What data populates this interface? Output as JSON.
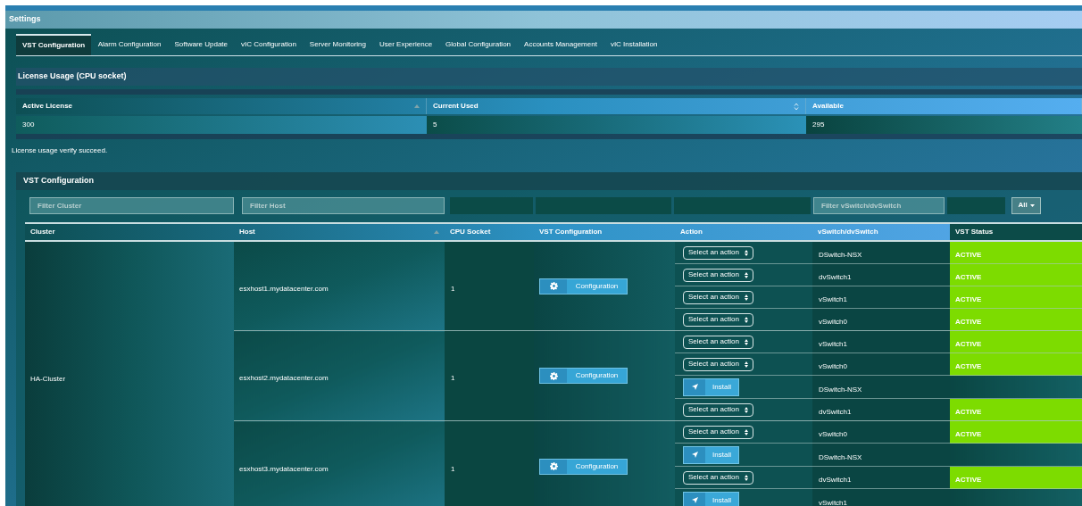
{
  "window": {
    "title": "Settings"
  },
  "tabs": [
    {
      "label": "VST Configuration",
      "selected": true
    },
    {
      "label": "Alarm Configuration",
      "selected": false
    },
    {
      "label": "Software Update",
      "selected": false
    },
    {
      "label": "vIC Configuration",
      "selected": false
    },
    {
      "label": "Server Monitoring",
      "selected": false
    },
    {
      "label": "User Experience",
      "selected": false
    },
    {
      "label": "Global Configuration",
      "selected": false
    },
    {
      "label": "Accounts Management",
      "selected": false
    },
    {
      "label": "vIC Installation",
      "selected": false
    }
  ],
  "license": {
    "title": "License Usage (CPU socket)",
    "columns": [
      {
        "label": "Active License",
        "sorted_ascending": true
      },
      {
        "label": "Current Used",
        "sortable": true
      },
      {
        "label": "Available"
      }
    ],
    "row": [
      "300",
      "5",
      "295"
    ],
    "message": "License usage verify succeed."
  },
  "vst": {
    "title": "VST Configuration",
    "filters": [
      {
        "placeholder": "Filter Cluster"
      },
      {
        "placeholder": "Filter Host"
      },
      {
        "placeholder": "Filter vSwitch/dvSwitch"
      }
    ],
    "status_filter": {
      "value": "All"
    },
    "columns": [
      {
        "label": "Cluster"
      },
      {
        "label": "Host",
        "sorted_ascending": true
      },
      {
        "label": "CPU Socket"
      },
      {
        "label": "VST Configuration"
      },
      {
        "label": "Action"
      },
      {
        "label": "vSwitch/dvSwitch"
      },
      {
        "label": "VST Status"
      }
    ],
    "clusters": [
      {
        "name": "HA-Cluster",
        "hosts": [
          {
            "host": "esxhost1.mydatacenter.com",
            "cpu": "1",
            "button": "Configuration",
            "switches": [
              {
                "action": {
                  "kind": "select",
                  "label": "Select an action"
                },
                "name": "DSwitch-NSX",
                "status": "ACTIVE"
              },
              {
                "action": {
                  "kind": "select",
                  "label": "Select an action"
                },
                "name": "dvSwitch1",
                "status": "ACTIVE"
              },
              {
                "action": {
                  "kind": "select",
                  "label": "Select an action"
                },
                "name": "vSwitch1",
                "status": "ACTIVE"
              },
              {
                "action": {
                  "kind": "select",
                  "label": "Select an action"
                },
                "name": "vSwitch0",
                "status": "ACTIVE"
              }
            ]
          },
          {
            "host": "esxhost2.mydatacenter.com",
            "cpu": "1",
            "button": "Configuration",
            "switches": [
              {
                "action": {
                  "kind": "select",
                  "label": "Select an action"
                },
                "name": "vSwitch1",
                "status": "ACTIVE"
              },
              {
                "action": {
                  "kind": "select",
                  "label": "Select an action"
                },
                "name": "vSwitch0",
                "status": "ACTIVE"
              },
              {
                "action": {
                  "kind": "install",
                  "label": "Install"
                },
                "name": "DSwitch-NSX"
              },
              {
                "action": {
                  "kind": "select",
                  "label": "Select an action"
                },
                "name": "dvSwitch1",
                "status": "ACTIVE"
              }
            ]
          },
          {
            "host": "esxhost3.mydatacenter.com",
            "cpu": "1",
            "button": "Configuration",
            "switches": [
              {
                "action": {
                  "kind": "select",
                  "label": "Select an action"
                },
                "name": "vSwitch0",
                "status": "ACTIVE"
              },
              {
                "action": {
                  "kind": "install",
                  "label": "Install"
                },
                "name": "DSwitch-NSX"
              },
              {
                "action": {
                  "kind": "select",
                  "label": "Select an action"
                },
                "name": "dvSwitch1",
                "status": "ACTIVE"
              },
              {
                "action": {
                  "kind": "install",
                  "label": "Install"
                },
                "name": "vSwitch1"
              }
            ]
          }
        ]
      }
    ]
  }
}
